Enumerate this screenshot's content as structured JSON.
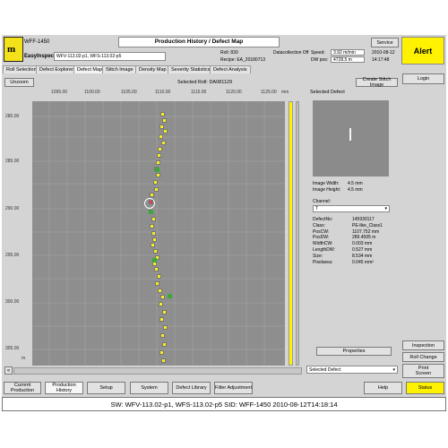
{
  "app": {
    "title": "WFF-1450",
    "name": "EasyInspect",
    "window_title": "Production History / Defect Map",
    "products": "WFV-113.02-p1, WFS-113.02-p5",
    "logo_letter": "m"
  },
  "header_info": {
    "roll": "Roll: 830",
    "datacollection": "Datacollection Off",
    "speed": "Speed:",
    "speed_value": "3.92 m/min",
    "recipe": "Recipe: EA_20180713",
    "dw_pos": "DW pos:",
    "dw_pos_value": "4728.5 m",
    "date": "2010-08-12",
    "time": "14:17:48",
    "service_label": "Service",
    "alert_label": "Alert"
  },
  "tabs": [
    "Roll Selection",
    "Defect Explorer",
    "Defect Map",
    "Stitch Image",
    "Density Map",
    "Severity Statistics",
    "Defect Analysis"
  ],
  "toolbar": {
    "unzoom_label": "Unzoom",
    "selected_roll": "Selected Roll: DA081129",
    "stitch_label": "Create Stitch Image",
    "login_label": "Login"
  },
  "axes": {
    "x_ticks": [
      "1095.00",
      "1100.00",
      "1105.00",
      "1110.00",
      "1115.00",
      "1120.00",
      "1125.00"
    ],
    "x_unit": "mm",
    "y_ticks": [
      "280.00",
      "285.00",
      "290.00",
      "295.00",
      "300.00",
      "305.00"
    ],
    "y_unit": "m"
  },
  "selected_defect": {
    "panel_title": "Selected Defect",
    "image_width_label": "Image Width:",
    "image_width_value": "4.5 mm",
    "image_height_label": "Image Height:",
    "image_height_value": "4.5 mm",
    "channel_label": "Channel:",
    "channel_value": "T",
    "fields": [
      {
        "label": "DefectNo:",
        "value": "145930117"
      },
      {
        "label": "Class:",
        "value": "PE-like_Class1"
      },
      {
        "label": "PosCW:",
        "value": "1107.752 mm"
      },
      {
        "label": "PosDW:",
        "value": "289.4595 m"
      },
      {
        "label": "WidthCW:",
        "value": "0.003 mm"
      },
      {
        "label": "LengthDW:",
        "value": "0.527 mm"
      },
      {
        "label": "Size:",
        "value": "8.534 mm"
      },
      {
        "label": "Pixelarea:",
        "value": "0.045 mm²"
      }
    ],
    "properties_label": "Properties",
    "dropdown_value": "Selected Defect"
  },
  "right_buttons": {
    "inspection": "Inspection",
    "roll_change": "Roll Change",
    "print_screen_1": "Print",
    "print_screen_2": "Screen"
  },
  "bottom_nav": {
    "current_production_1": "Current",
    "current_production_2": "Production",
    "production_history_1": "Production",
    "production_history_2": "History",
    "setup": "Setup",
    "system": "System",
    "defect_library": "Defect Library",
    "filter_adjustment": "Filter Adjustment",
    "help": "Help",
    "status": "Status"
  },
  "scroll_left_label": "«",
  "status_bar": "SW: WFV-113.02-p1, WFS-113.02-p5  SID: WFF-1450  2010-08-12T14:18:14",
  "colors": {
    "defect_marker": "#f7ef1e",
    "classified_marker": "#3da83a",
    "alert": "#fff200",
    "plot_bg": "#8e8e8e"
  }
}
